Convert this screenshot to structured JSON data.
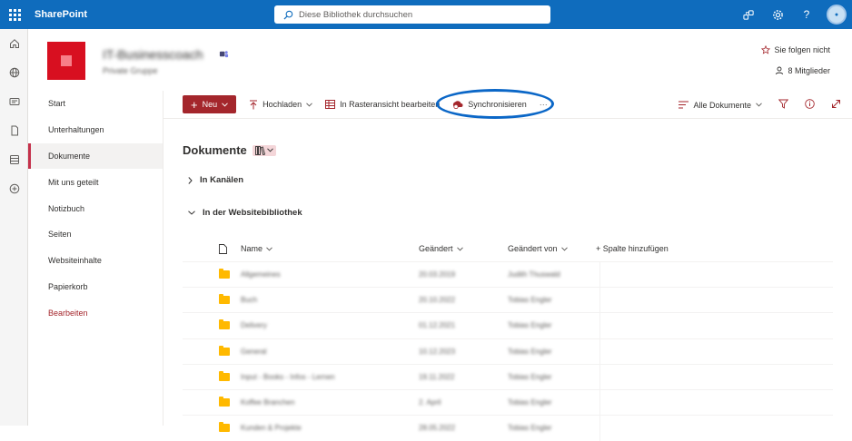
{
  "topbar": {
    "app_name": "SharePoint",
    "search_placeholder": "Diese Bibliothek durchsuchen"
  },
  "site": {
    "title": "IT-Businesscoach",
    "subtitle": "Private Gruppe",
    "follow_label": "Sie folgen nicht",
    "members_label": "8 Mitglieder"
  },
  "nav": [
    {
      "label": "Start"
    },
    {
      "label": "Unterhaltungen"
    },
    {
      "label": "Dokumente"
    },
    {
      "label": "Mit uns geteilt"
    },
    {
      "label": "Notizbuch"
    },
    {
      "label": "Seiten"
    },
    {
      "label": "Websiteinhalte"
    },
    {
      "label": "Papierkorb"
    },
    {
      "label": "Bearbeiten"
    }
  ],
  "commands": {
    "new_label": "Neu",
    "upload_label": "Hochladen",
    "grid_label": "In Rasteransicht bearbeiten",
    "sync_label": "Synchronisieren",
    "more_label": "···",
    "view_label": "Alle Dokumente"
  },
  "library": {
    "title": "Dokumente",
    "group_channels": "In Kanälen",
    "group_site": "In der Websitebibliothek"
  },
  "columns": {
    "name": "Name",
    "modified": "Geändert",
    "modified_by": "Geändert von",
    "add_column": "+ Spalte hinzufügen"
  },
  "rows": [
    {
      "name": "Allgemeines",
      "modified": "20.03.2019",
      "by": "Judith Thuswald"
    },
    {
      "name": "Buch",
      "modified": "20.10.2022",
      "by": "Tobias Engler"
    },
    {
      "name": "Delivery",
      "modified": "01.12.2021",
      "by": "Tobias Engler"
    },
    {
      "name": "General",
      "modified": "10.12.2023",
      "by": "Tobias Engler"
    },
    {
      "name": "Input - Books - Infos - Lernen",
      "modified": "19.11.2022",
      "by": "Tobias Engler"
    },
    {
      "name": "Koffee Branchen",
      "modified": "2. April",
      "by": "Tobias Engler"
    },
    {
      "name": "Kunden & Projekte",
      "modified": "28.05.2022",
      "by": "Tobias Engler"
    }
  ],
  "colors": {
    "topbar": "#0f6cbd",
    "accent": "#a4262c",
    "highlight": "#0b67c7"
  }
}
